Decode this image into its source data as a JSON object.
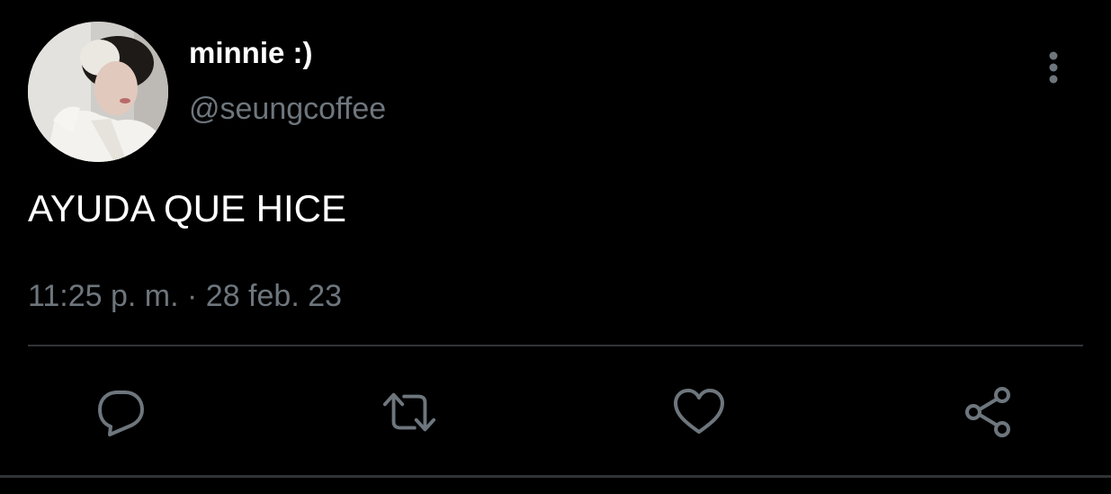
{
  "user": {
    "display_name": "minnie :)",
    "handle": "@seungcoffee"
  },
  "tweet": {
    "text": "AYUDA QUE HICE",
    "timestamp": "11:25 p. m. · 28 feb. 23"
  },
  "actions": {
    "reply_icon": "reply-icon",
    "retweet_icon": "retweet-icon",
    "like_icon": "heart-icon",
    "share_icon": "share-icon",
    "more_icon": "vertical-dots-icon"
  },
  "colors": {
    "background": "#000000",
    "primary_text": "#ffffff",
    "secondary_text": "#6e767d",
    "divider": "#2f3336",
    "icon": "#6e767d"
  }
}
